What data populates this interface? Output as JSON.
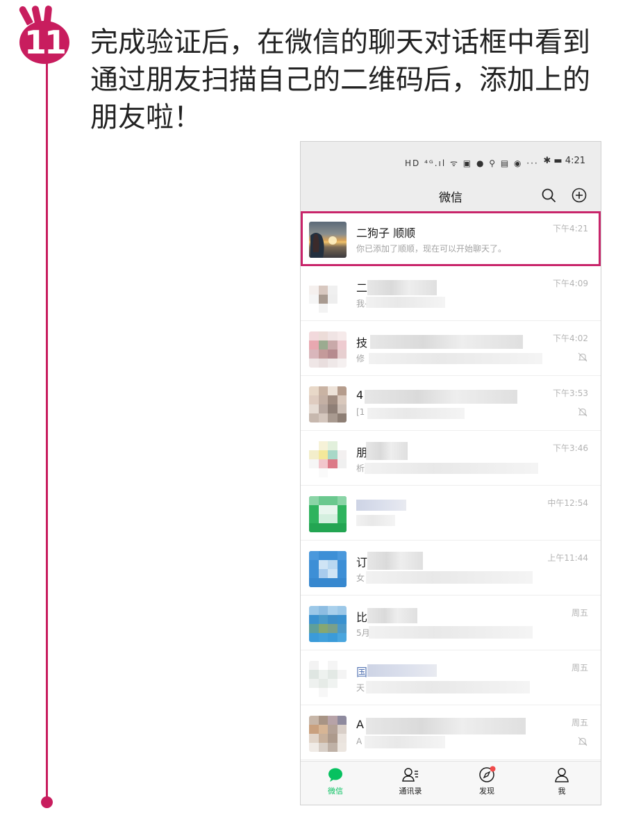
{
  "step": {
    "number": "11",
    "text": "完成验证后，在微信的聊天对话框中看到通过朋友扫描自己的二维码后，添加上的朋友啦！"
  },
  "colors": {
    "accent": "#c81d5e",
    "wechat_green": "#07c160",
    "highlight": "#c8246a"
  },
  "statusbar": {
    "icons": "HD ⁴ᴳ.ıl ᯤ ▣ ● ⚲ ▤ ◉ ···",
    "right": "✱ ▬ 4:21"
  },
  "header": {
    "title": "微信",
    "search_icon": "search-icon",
    "add_icon": "plus-circle-icon"
  },
  "chats": [
    {
      "name": "二狗子 顺顺",
      "preview": "你已添加了顺顺，现在可以开始聊天了。",
      "time": "下午4:21",
      "muted": false
    },
    {
      "name": "二",
      "preview": "我-",
      "time": "下午4:09",
      "muted": false
    },
    {
      "name": "技",
      "preview": "修",
      "time": "下午4:02",
      "muted": true
    },
    {
      "name": "4",
      "preview": "[1",
      "time": "下午3:53",
      "muted": true
    },
    {
      "name": "朋",
      "preview": "析",
      "time": "下午3:46",
      "muted": false
    },
    {
      "name": "",
      "preview": "",
      "time": "中午12:54",
      "muted": false
    },
    {
      "name": "订",
      "preview": "女",
      "time": "上午11:44",
      "muted": false
    },
    {
      "name": "比",
      "preview": "5月",
      "time": "周五",
      "muted": false
    },
    {
      "name": "国",
      "preview": "天",
      "time": "周五",
      "muted": false
    },
    {
      "name": "A",
      "preview": "A",
      "time": "周五",
      "muted": true
    }
  ],
  "tabs": [
    {
      "label": "微信",
      "icon": "chat-bubble-icon",
      "active": true
    },
    {
      "label": "通讯录",
      "icon": "contacts-icon",
      "active": false
    },
    {
      "label": "发现",
      "icon": "compass-icon",
      "active": false
    },
    {
      "label": "我",
      "icon": "person-icon",
      "active": false
    }
  ]
}
